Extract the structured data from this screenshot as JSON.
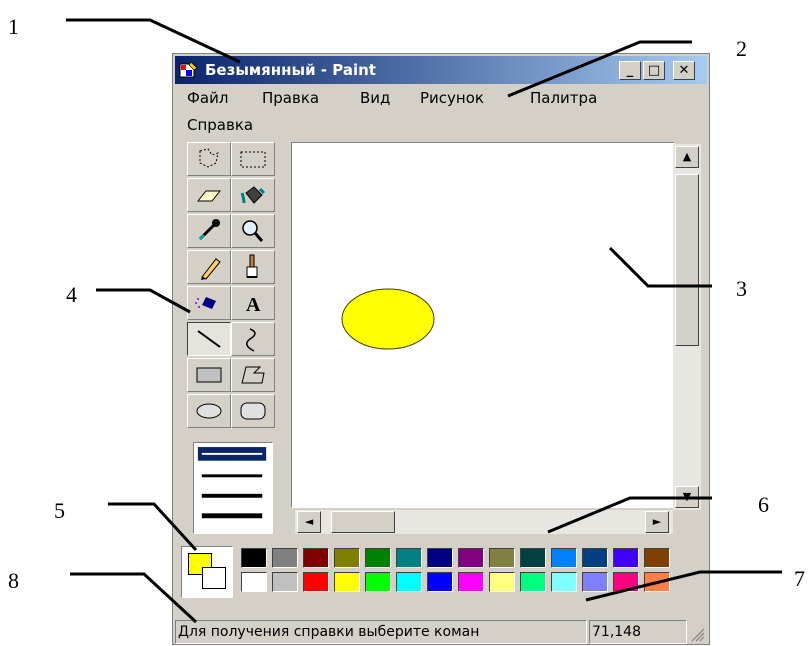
{
  "callouts": [
    "1",
    "2",
    "3",
    "4",
    "5",
    "6",
    "7",
    "8"
  ],
  "window": {
    "title": "Безымянный - Paint",
    "buttons": {
      "minimize": "_",
      "maximize": "□",
      "close": "✕"
    }
  },
  "menu": [
    "Файл",
    "Правка",
    "Вид",
    "Рисунок",
    "Палитра",
    "Справка"
  ],
  "toolbox": {
    "tools": [
      "free-select",
      "rect-select",
      "eraser",
      "fill",
      "color-picker",
      "magnifier",
      "pencil",
      "brush",
      "airbrush",
      "text",
      "line",
      "curve",
      "rectangle",
      "polygon",
      "ellipse",
      "rounded-rectangle"
    ],
    "active_tool": "line",
    "text_tool_glyph": "A"
  },
  "canvas": {
    "shape": "ellipse",
    "fill": "#ffff00"
  },
  "scrollbar_arrows": {
    "up": "▲",
    "down": "▼",
    "left": "◄",
    "right": "►"
  },
  "palette": {
    "foreground": "#ffff00",
    "background": "#ffffff",
    "row1": [
      "#000000",
      "#808080",
      "#800000",
      "#808000",
      "#008000",
      "#008080",
      "#000080",
      "#800080",
      "#808040",
      "#004040",
      "#0080ff",
      "#004080",
      "#4000ff",
      "#804000"
    ],
    "row2": [
      "#ffffff",
      "#c0c0c0",
      "#ff0000",
      "#ffff00",
      "#00ff00",
      "#00ffff",
      "#0000ff",
      "#ff00ff",
      "#ffff80",
      "#00ff80",
      "#80ffff",
      "#8080ff",
      "#ff0080",
      "#ff8040"
    ]
  },
  "status": {
    "text": "Для получения справки выберите коман",
    "coords": "71,148"
  }
}
